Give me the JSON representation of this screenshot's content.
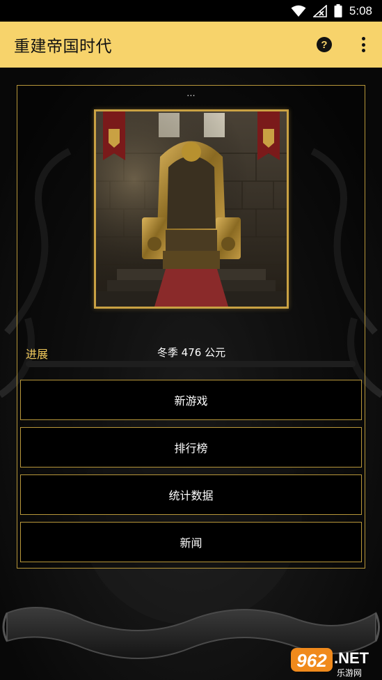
{
  "status_bar": {
    "time": "5:08",
    "icons": [
      "wifi-icon",
      "no-signal-icon",
      "battery-icon"
    ]
  },
  "app_bar": {
    "title": "重建帝国时代",
    "actions": [
      "help-icon",
      "more-vert-icon"
    ]
  },
  "panel": {
    "ellipsis": "...",
    "image": "throne-room",
    "progress": {
      "label": "进展",
      "value": "冬季 476 公元",
      "fraction": 0.0
    },
    "buttons": [
      {
        "label": "新游戏"
      },
      {
        "label": "排行榜"
      },
      {
        "label": "统计数据"
      },
      {
        "label": "新闻"
      }
    ]
  },
  "watermark": {
    "logo": "962",
    "suffix": ".NET",
    "caption": "乐游网"
  },
  "colors": {
    "app_bar_bg": "#f7d36b",
    "accent_gold": "#b8973a",
    "progress_label": "#f0c85a",
    "background": "#0b0b0b"
  }
}
